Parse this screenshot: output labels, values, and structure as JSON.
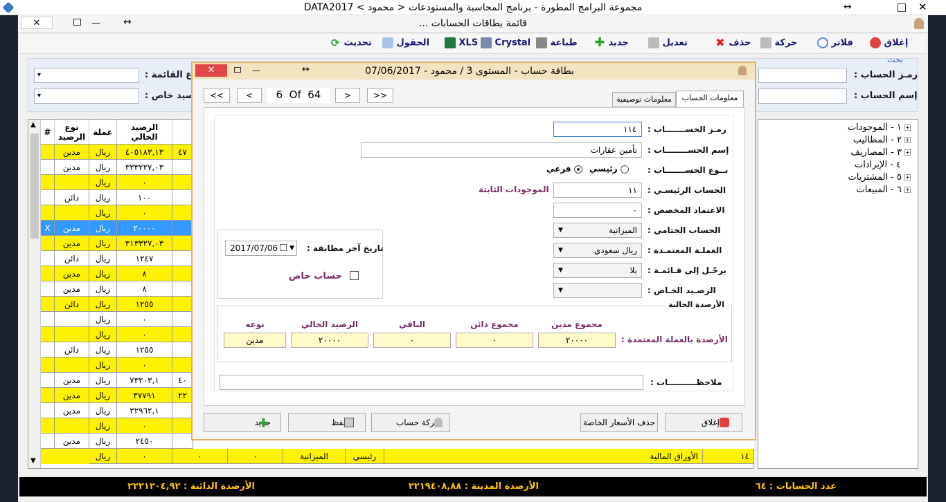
{
  "window": {
    "title": "مجموعة البرامج المطورة - برنامج المحاسبة والمستودعات < محمود > DATA2017"
  },
  "child_window": {
    "title": "قائمة بطاقات الحسابات ..."
  },
  "toolbar": [
    {
      "label": "إغلاق",
      "icon": "exit-icon",
      "color": "#e04040"
    },
    {
      "label": "فلاتر",
      "icon": "filter-icon",
      "color": "#5b8bd8"
    },
    {
      "label": "حركة",
      "icon": "movement-icon",
      "color": "#999999"
    },
    {
      "label": "حذف",
      "icon": "delete-icon",
      "color": "#e02020"
    },
    {
      "label": "تعديل",
      "icon": "edit-icon",
      "color": "#999999"
    },
    {
      "label": "جديد",
      "icon": "plus-icon",
      "color": "#2fa02f"
    },
    {
      "label": "طباعة",
      "icon": "print-icon",
      "color": "#777777"
    },
    {
      "label": "Crystal",
      "icon": "crystal-icon",
      "color": "#6a7aa0"
    },
    {
      "label": "XLS",
      "icon": "excel-icon",
      "color": "#1f7a3c"
    },
    {
      "label": "الحقول",
      "icon": "fields-icon",
      "color": "#7aa0d8"
    },
    {
      "label": "تحديث",
      "icon": "refresh-icon",
      "color": "#2fa02f"
    }
  ],
  "search": {
    "panel_title": "بحث",
    "account_code_label": "رمـز الحساب :",
    "account_name_label": "إسم الحساب :",
    "list_type_label": "وع القائمة :",
    "special_balance_label": "صيد خاص :"
  },
  "grid": {
    "headers": {
      "hash": "#",
      "balance_type": "نوع الرصيد",
      "currency": "عملة",
      "current_balance": "الرصيد الحالي"
    },
    "rows": [
      {
        "balance_type": "مدين",
        "currency": "ريال",
        "balance": "٤٠٥١٨٣,١٣",
        "extra": "٤٧",
        "style": "yellow"
      },
      {
        "balance_type": "مدين",
        "currency": "ريال",
        "balance": "٣٣٣٢٢٧,٠٣",
        "extra": "",
        "style": "white"
      },
      {
        "balance_type": "",
        "currency": "ريال",
        "balance": "٠",
        "extra": "",
        "style": "yellow"
      },
      {
        "balance_type": "دائن",
        "currency": "ريال",
        "balance": "١٠٠",
        "extra": "",
        "style": "white"
      },
      {
        "balance_type": "",
        "currency": "ريال",
        "balance": "٠",
        "extra": "",
        "style": "yellow"
      },
      {
        "hash": "X",
        "balance_type": "مدين",
        "currency": "ريال",
        "balance": "٢٠٠٠٠",
        "extra": "",
        "style": "selected"
      },
      {
        "balance_type": "مدين",
        "currency": "ريال",
        "balance": "٣١٣٣٢٧,٠٣",
        "extra": "",
        "style": "yellow"
      },
      {
        "balance_type": "دائن",
        "currency": "ريال",
        "balance": "١٢٤٧",
        "extra": "",
        "style": "white"
      },
      {
        "balance_type": "مدين",
        "currency": "ريال",
        "balance": "٨",
        "extra": "",
        "style": "yellow"
      },
      {
        "balance_type": "مدين",
        "currency": "ريال",
        "balance": "٨",
        "extra": "",
        "style": "white"
      },
      {
        "balance_type": "دائن",
        "currency": "ريال",
        "balance": "١٢٥٥",
        "extra": "",
        "style": "yellow"
      },
      {
        "balance_type": "",
        "currency": "ريال",
        "balance": "٠",
        "extra": "",
        "style": "white"
      },
      {
        "balance_type": "",
        "currency": "ريال",
        "balance": "٠",
        "extra": "",
        "style": "yellow"
      },
      {
        "balance_type": "دائن",
        "currency": "ريال",
        "balance": "١٢٥٥",
        "extra": "",
        "style": "white"
      },
      {
        "balance_type": "",
        "currency": "ريال",
        "balance": "٠",
        "extra": "",
        "style": "yellow"
      },
      {
        "balance_type": "مدين",
        "currency": "ريال",
        "balance": "٧٣٢٠٣,١",
        "extra": "٤٠",
        "style": "white"
      },
      {
        "balance_type": "مدين",
        "currency": "ريال",
        "balance": "٣٧٧٩١",
        "extra": "٢٢",
        "style": "yellow"
      },
      {
        "balance_type": "مدين",
        "currency": "ريال",
        "balance": "٣٢٩٦٢,١",
        "extra": "",
        "style": "white"
      },
      {
        "balance_type": "",
        "currency": "ريال",
        "balance": "٠",
        "extra": "",
        "style": "yellow"
      },
      {
        "balance_type": "مدين",
        "currency": "ريال",
        "balance": "٢٤٥٠",
        "extra": "",
        "style": "white"
      }
    ],
    "last_row": {
      "code": "١٤",
      "name": "الأوراق المالية",
      "kind": "رئيسي",
      "final": "الميزانية",
      "c1": "٠",
      "c2": "٠",
      "balance": "٠",
      "currency": "ريال"
    }
  },
  "tree": [
    {
      "label": "١ - الموجودات",
      "expandable": true
    },
    {
      "label": "٢ - المطاليب",
      "expandable": true
    },
    {
      "label": "٣ - المصاريف",
      "expandable": true
    },
    {
      "label": "٤ - الإيرادات",
      "expandable": false
    },
    {
      "label": "٥ - المشتريات",
      "expandable": true
    },
    {
      "label": "٦ - المبيعات",
      "expandable": true
    }
  ],
  "status": {
    "account_count": "عدد الحسابات : ٦٤",
    "debit_balances": "الأرصدة المدينة : ٢٢١٩٤٠٨,٨٨",
    "credit_balances": "الأرصدة الدائنة : ٢٢٢١٢٠٤,٩٢"
  },
  "dialog": {
    "title": "بطاقة حساب - المستوى 3 / محمود - 07/06/2017",
    "nav": {
      "first": "<<",
      "prev": "<",
      "position": "6  Of  64",
      "next": ">",
      "last": ">>"
    },
    "tabs": {
      "account_info": "معلومات الحساب",
      "descriptive_info": "معلومات توصيفية"
    },
    "fields": {
      "code_label": "رمـز الحســـــــاب :",
      "code_value": "١١٤",
      "name_label": "إسم الحســــــــاب :",
      "name_value": "تأمين عقارات",
      "type_label": "نــوع الحســـــــاب :",
      "type_main": "رئيسي",
      "type_sub": "فرعي",
      "parent_label": "الحساب الرئيسـي :",
      "parent_value": "١١",
      "parent_name": "الموجودات الثابتة",
      "credit_label": "الاعتماد المخصص :",
      "credit_value": "٠",
      "final_label": "الحساب الختامي :",
      "final_value": "الميزانية",
      "currency_label": "العملـة المعتمـدة :",
      "currency_value": "ريال سعودي",
      "transfer_label": "يرحّـل إلى قـائمـة :",
      "transfer_value": "بلا",
      "special_label": "الرصـيد الخـاص :",
      "special_value": "",
      "last_match_label": "تاريخ آخر مطابقة :",
      "last_match_value": "2017/07/06",
      "private_label": "حساب خاص"
    },
    "balances": {
      "group_title": "الأرصدة الحالية",
      "row_label": "الأرصدة بالعملة المعتمدة :",
      "headers": [
        "مجموع مدين",
        "مجموع دائن",
        "الباقي",
        "الرصيد الحالي",
        "نوعه"
      ],
      "values": [
        "٢٠٠٠٠",
        "٠",
        "٠",
        "٢٠٠٠٠",
        "مدين"
      ]
    },
    "notes_label": "ملاحظــــــــــات :",
    "buttons": {
      "close": "إغلاق",
      "delete_prices": "حذف الأسعار الخاصة",
      "movement": "حركة حساب",
      "save": "حفظ",
      "new": "جديد"
    }
  }
}
